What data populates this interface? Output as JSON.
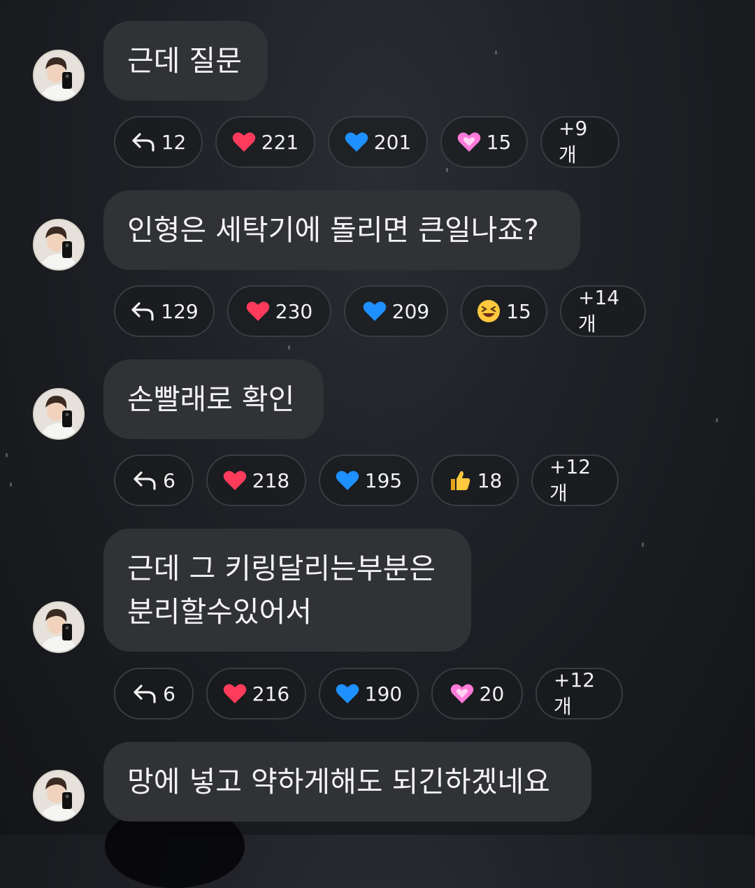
{
  "messages": [
    {
      "text": "근데 질문",
      "reactions": {
        "reply": "12",
        "r1": "221",
        "r2": "201",
        "r3": "15",
        "more": "+9개"
      }
    },
    {
      "text": "인형은 세탁기에 돌리면 큰일나죠?",
      "reactions": {
        "reply": "129",
        "r1": "230",
        "r2": "209",
        "r3": "15",
        "more": "+14개"
      }
    },
    {
      "text": "손빨래로 확인",
      "reactions": {
        "reply": "6",
        "r1": "218",
        "r2": "195",
        "r3": "18",
        "more": "+12개"
      }
    },
    {
      "line1": "근데 그 키링달리는부분은",
      "line2": "분리할수있어서",
      "reactions": {
        "reply": "6",
        "r1": "216",
        "r2": "190",
        "r3": "20",
        "more": "+12개"
      }
    },
    {
      "text": "망에 넣고 약하게해도 되긴하겠네요"
    }
  ],
  "icons": {
    "reply": "reply-arrow-icon",
    "red_heart": "red-heart-icon",
    "blue_heart": "blue-heart-icon",
    "pink_heart": "pink-heart-icon",
    "laughing_face": "laughing-face-icon",
    "thumbs_up": "thumbs-up-icon"
  },
  "colors": {
    "bubble": "#303236",
    "red_heart": "#ff3b5c",
    "blue_heart": "#1e90ff",
    "pink_heart": "#ff7ad9"
  }
}
